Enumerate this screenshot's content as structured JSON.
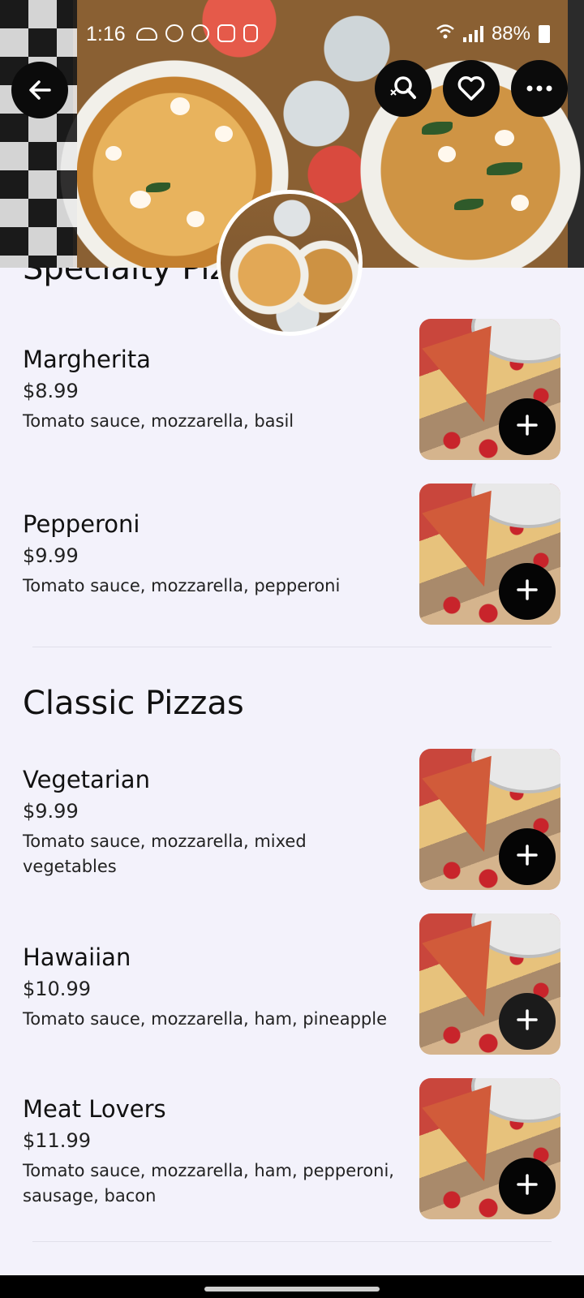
{
  "status_bar": {
    "time": "1:16",
    "battery": "88%"
  },
  "header_actions": {
    "back_icon": "arrow-left-icon",
    "search_icon": "search-icon",
    "favorite_icon": "heart-icon",
    "more_icon": "more-icon"
  },
  "menu": {
    "sections": [
      {
        "title": "Specialty Piz",
        "items": [
          {
            "name": "Margherita",
            "price": "$8.99",
            "description": "Tomato sauce, mozzarella, basil"
          },
          {
            "name": "Pepperoni",
            "price": "$9.99",
            "description": "Tomato sauce, mozzarella, pepperoni"
          }
        ]
      },
      {
        "title": "Classic Pizzas",
        "items": [
          {
            "name": "Vegetarian",
            "price": "$9.99",
            "description": "Tomato sauce, mozzarella, mixed vegetables"
          },
          {
            "name": "Hawaiian",
            "price": "$10.99",
            "description": "Tomato sauce, mozzarella, ham, pineapple"
          },
          {
            "name": "Meat Lovers",
            "price": "$11.99",
            "description": "Tomato sauce, mozzarella, ham, pepperoni, sausage, bacon"
          }
        ]
      }
    ]
  },
  "colors": {
    "background": "#f3f2fb",
    "button": "#050505"
  }
}
